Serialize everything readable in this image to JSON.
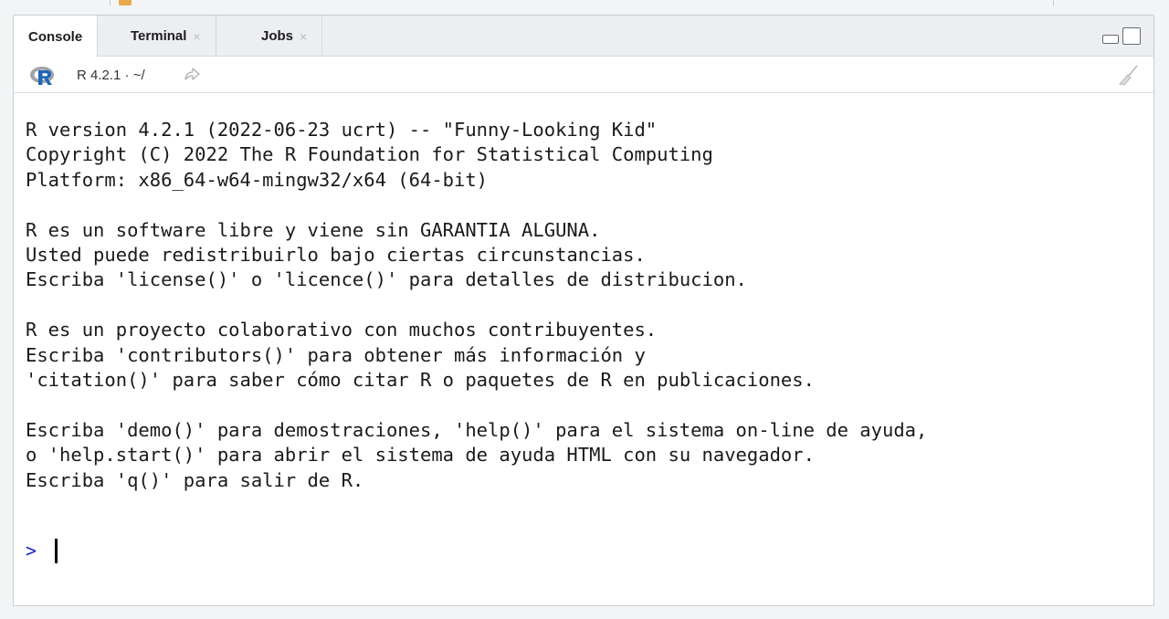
{
  "pane": {
    "tabs": [
      {
        "label": "Console",
        "active": true,
        "closable": false
      },
      {
        "label": "Terminal",
        "active": false,
        "closable": true
      },
      {
        "label": "Jobs",
        "active": false,
        "closable": true
      }
    ],
    "close_glyph": "×",
    "window_controls": [
      "minimize-icon",
      "maximize-icon"
    ]
  },
  "toolbar": {
    "r_logo_icon": "r-logo-icon",
    "version_path": "R 4.2.1 · ~/",
    "go_to_dir_icon": "go-to-directory-icon",
    "clear_console_icon": "broom-icon"
  },
  "console": {
    "lines": [
      "R version 4.2.1 (2022-06-23 ucrt) -- \"Funny-Looking Kid\"",
      "Copyright (C) 2022 The R Foundation for Statistical Computing",
      "Platform: x86_64-w64-mingw32/x64 (64-bit)",
      "",
      "R es un software libre y viene sin GARANTIA ALGUNA.",
      "Usted puede redistribuirlo bajo ciertas circunstancias.",
      "Escriba 'license()' o 'licence()' para detalles de distribucion.",
      "",
      "R es un proyecto colaborativo con muchos contribuyentes.",
      "Escriba 'contributors()' para obtener más información y",
      "'citation()' para saber cómo citar R o paquetes de R en publicaciones.",
      "",
      "Escriba 'demo()' para demostraciones, 'help()' para el sistema on-line de ayuda,",
      "o 'help.start()' para abrir el sistema de ayuda HTML con su navegador.",
      "Escriba 'q()' para salir de R."
    ],
    "prompt": ">",
    "input_value": ""
  },
  "colors": {
    "prompt": "#2222cc",
    "r_logo_blue": "#2165b6",
    "r_logo_grey": "#9ea3a8"
  }
}
